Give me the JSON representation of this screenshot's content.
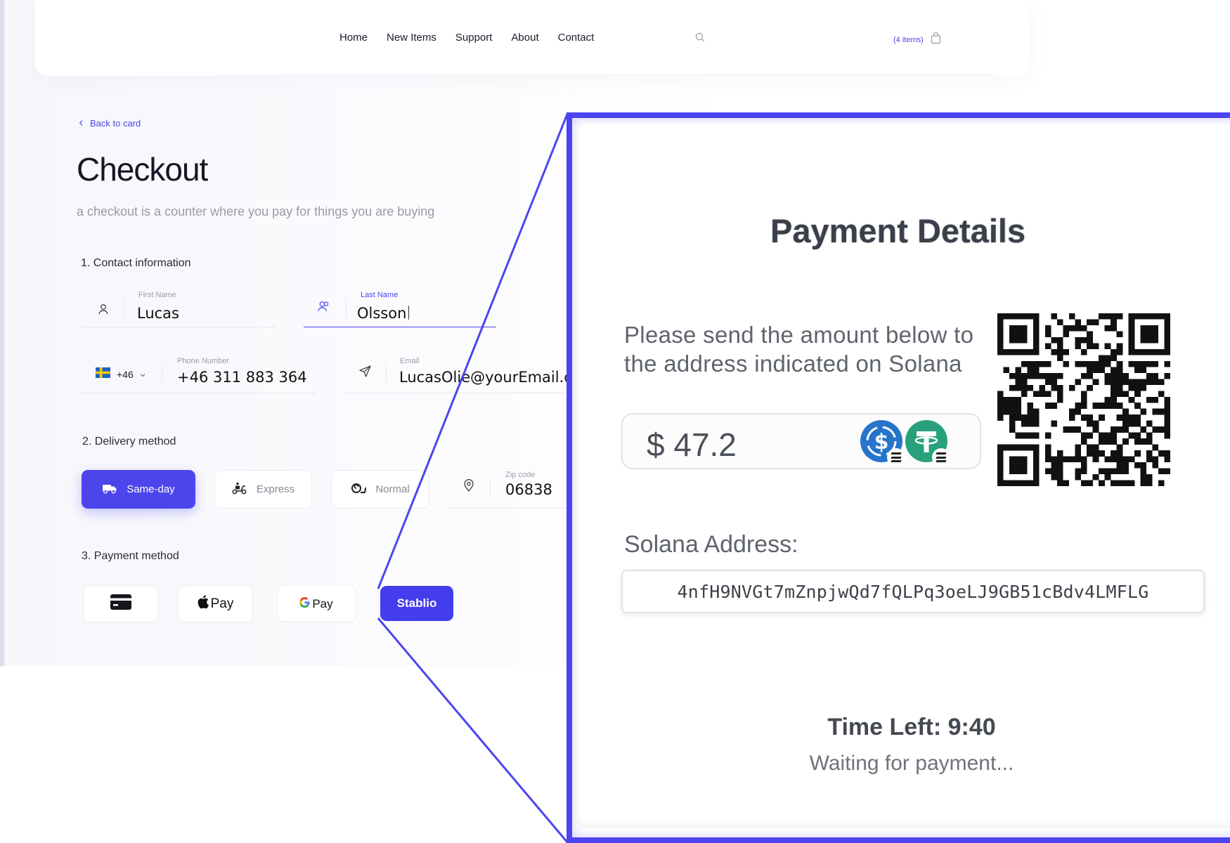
{
  "nav": {
    "links": [
      "Home",
      "New Items",
      "Support",
      "About",
      "Contact"
    ],
    "cart_count": "(4 items)"
  },
  "checkout": {
    "back_link": "Back to card",
    "title": "Checkout",
    "subtitle": "a checkout is a counter where you pay for things you are buying",
    "sections": {
      "contact": "1. Contact information",
      "delivery": "2. Delivery method",
      "payment": "3. Payment method"
    },
    "first_name": {
      "label": "First Name",
      "value": "Lucas"
    },
    "last_name": {
      "label": "Last Name",
      "value": "Olsson"
    },
    "country_code": "+46",
    "phone": {
      "label": "Phone Number",
      "value": "+46 311 883 364"
    },
    "email": {
      "label": "Email",
      "value": "LucasOlie@yourEmail.co"
    },
    "delivery_options": [
      "Same-day",
      "Express",
      "Normal"
    ],
    "zip": {
      "label": "Zip code",
      "value": "06838"
    },
    "payment_options": {
      "apple_pay": "Pay",
      "google_pay": "Pay",
      "stablio": "Stablio"
    }
  },
  "payment_panel": {
    "title": "Payment Details",
    "instructions": "Please send the amount below to the address indicated on Solana",
    "amount": "$ 47.2",
    "coins": [
      "usdc-icon",
      "usdt-icon"
    ],
    "address_label": "Solana Address:",
    "address": "4nfH9NVGt7mZnpjwQd7fQLPq3oeLJ9GB51cBdv4LMFLG",
    "time_left": "Time Left: 9:40",
    "status": "Waiting for payment..."
  },
  "colors": {
    "accent": "#4c45ec",
    "usdc": "#2775ca",
    "usdt": "#26a17b"
  }
}
